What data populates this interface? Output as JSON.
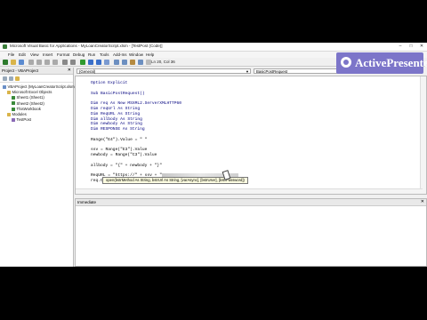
{
  "window": {
    "title": "Microsoft Visual Basic for Applications - MyLoanCreatorScript.xlsm - [TestPost (Code)]",
    "minimize": "–",
    "maximize": "□",
    "close": "✕"
  },
  "menu": [
    "File",
    "Edit",
    "View",
    "Insert",
    "Format",
    "Debug",
    "Run",
    "Tools",
    "Add-Ins",
    "Window",
    "Help"
  ],
  "toolbar": {
    "status": "Ln 20, Col 36"
  },
  "project": {
    "title": "Project - VBAProject",
    "close": "✕",
    "tree": [
      {
        "label": "VBAProject (MyLoanCreatorScript.xlsm)",
        "level": 0,
        "color": "#6a8fc7"
      },
      {
        "label": "Microsoft Excel Objects",
        "level": 1,
        "color": "#d9b44a"
      },
      {
        "label": "Sheet1 (Sheet1)",
        "level": 2,
        "color": "#3a8a3a"
      },
      {
        "label": "Sheet2 (Sheet2)",
        "level": 2,
        "color": "#3a8a3a"
      },
      {
        "label": "ThisWorkbook",
        "level": 2,
        "color": "#3a8a3a"
      },
      {
        "label": "Modules",
        "level": 1,
        "color": "#d9b44a"
      },
      {
        "label": "TestPost",
        "level": 2,
        "color": "#8a6ab5"
      }
    ]
  },
  "combos": {
    "object": "(General)",
    "procedure": "BasicPostRequest"
  },
  "code": {
    "lines": [
      {
        "text": "Option Explicit",
        "kw": true
      },
      {
        "text": "",
        "kw": false
      },
      {
        "text": "Sub BasicPostRequest()",
        "kw": true
      },
      {
        "text": "",
        "kw": false
      },
      {
        "text": "Dim req As New MSXML2.ServerXMLHTTP60",
        "kw": true
      },
      {
        "text": "Dim reqUrl As String",
        "kw": true
      },
      {
        "text": "Dim ReqURL As String",
        "kw": true
      },
      {
        "text": "Dim allbody As String",
        "kw": true
      },
      {
        "text": "Dim newbody As String",
        "kw": true
      },
      {
        "text": "Dim RESPONSE As String",
        "kw": true
      },
      {
        "text": "",
        "kw": false
      },
      {
        "text": "Range(\"E4\").Value = \" \"",
        "kw": false
      },
      {
        "text": "",
        "kw": false
      },
      {
        "text": "ssv = Range(\"E3\").Value",
        "kw": false
      },
      {
        "text": "newbody = Range(\"C3\").Value",
        "kw": false
      },
      {
        "text": "",
        "kw": false
      },
      {
        "text": "allbody = \"{\" + newbody + \"}\"",
        "kw": false
      },
      {
        "text": "",
        "kw": false
      },
      {
        "text": "ReqURL = \"https://\" + ssv + \"",
        "kw": false,
        "blurred": true
      },
      {
        "text": "req.Open \"POST\", reqURL,",
        "kw": false
      }
    ],
    "tooltip": "open(bstrMethod As String, bstrUrl As String, [varAsync], [bstrUser], [bstrPassword])"
  },
  "immediate": {
    "title": "Immediate",
    "close": "✕"
  },
  "watermark": {
    "text": "ActivePresenter"
  }
}
